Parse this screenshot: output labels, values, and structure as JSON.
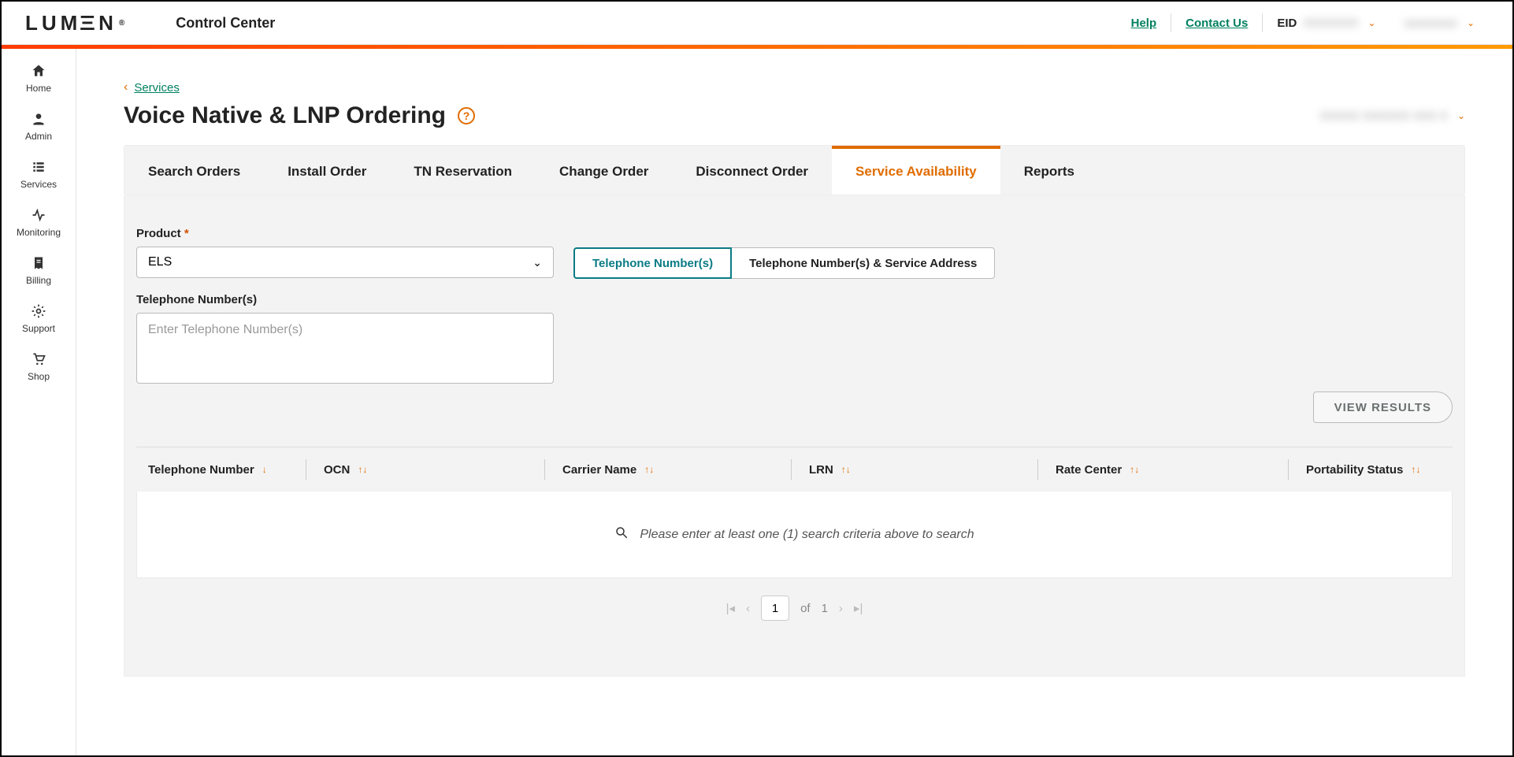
{
  "header": {
    "logo_text": "LUMEN",
    "logo_reg": "®",
    "app_name": "Control Center",
    "help": "Help",
    "contact": "Contact Us",
    "eid_label": "EID",
    "eid_value": "XXXXXXX",
    "user_value": "xxxxxxxxx"
  },
  "sidebar": {
    "items": [
      {
        "label": "Home"
      },
      {
        "label": "Admin"
      },
      {
        "label": "Services"
      },
      {
        "label": "Monitoring"
      },
      {
        "label": "Billing"
      },
      {
        "label": "Support"
      },
      {
        "label": "Shop"
      }
    ]
  },
  "breadcrumb": {
    "back_label": "Services"
  },
  "page": {
    "title": "Voice Native & LNP Ordering",
    "account": "XXXXX XXXXXX XXX X"
  },
  "tabs": [
    {
      "label": "Search Orders"
    },
    {
      "label": "Install Order"
    },
    {
      "label": "TN Reservation"
    },
    {
      "label": "Change Order"
    },
    {
      "label": "Disconnect Order"
    },
    {
      "label": "Service Availability"
    },
    {
      "label": "Reports"
    }
  ],
  "form": {
    "product_label": "Product",
    "product_required": "*",
    "product_value": "ELS",
    "seg_tn": "Telephone Number(s)",
    "seg_tn_addr": "Telephone Number(s) & Service Address",
    "tn_label": "Telephone Number(s)",
    "tn_placeholder": "Enter Telephone Number(s)",
    "view_results": "VIEW RESULTS"
  },
  "table": {
    "columns": [
      "Telephone Number",
      "OCN",
      "Carrier Name",
      "LRN",
      "Rate Center",
      "Portability Status"
    ],
    "empty_message": "Please enter at least one (1) search criteria above to search"
  },
  "pager": {
    "current": "1",
    "of_label": "of",
    "total": "1"
  }
}
